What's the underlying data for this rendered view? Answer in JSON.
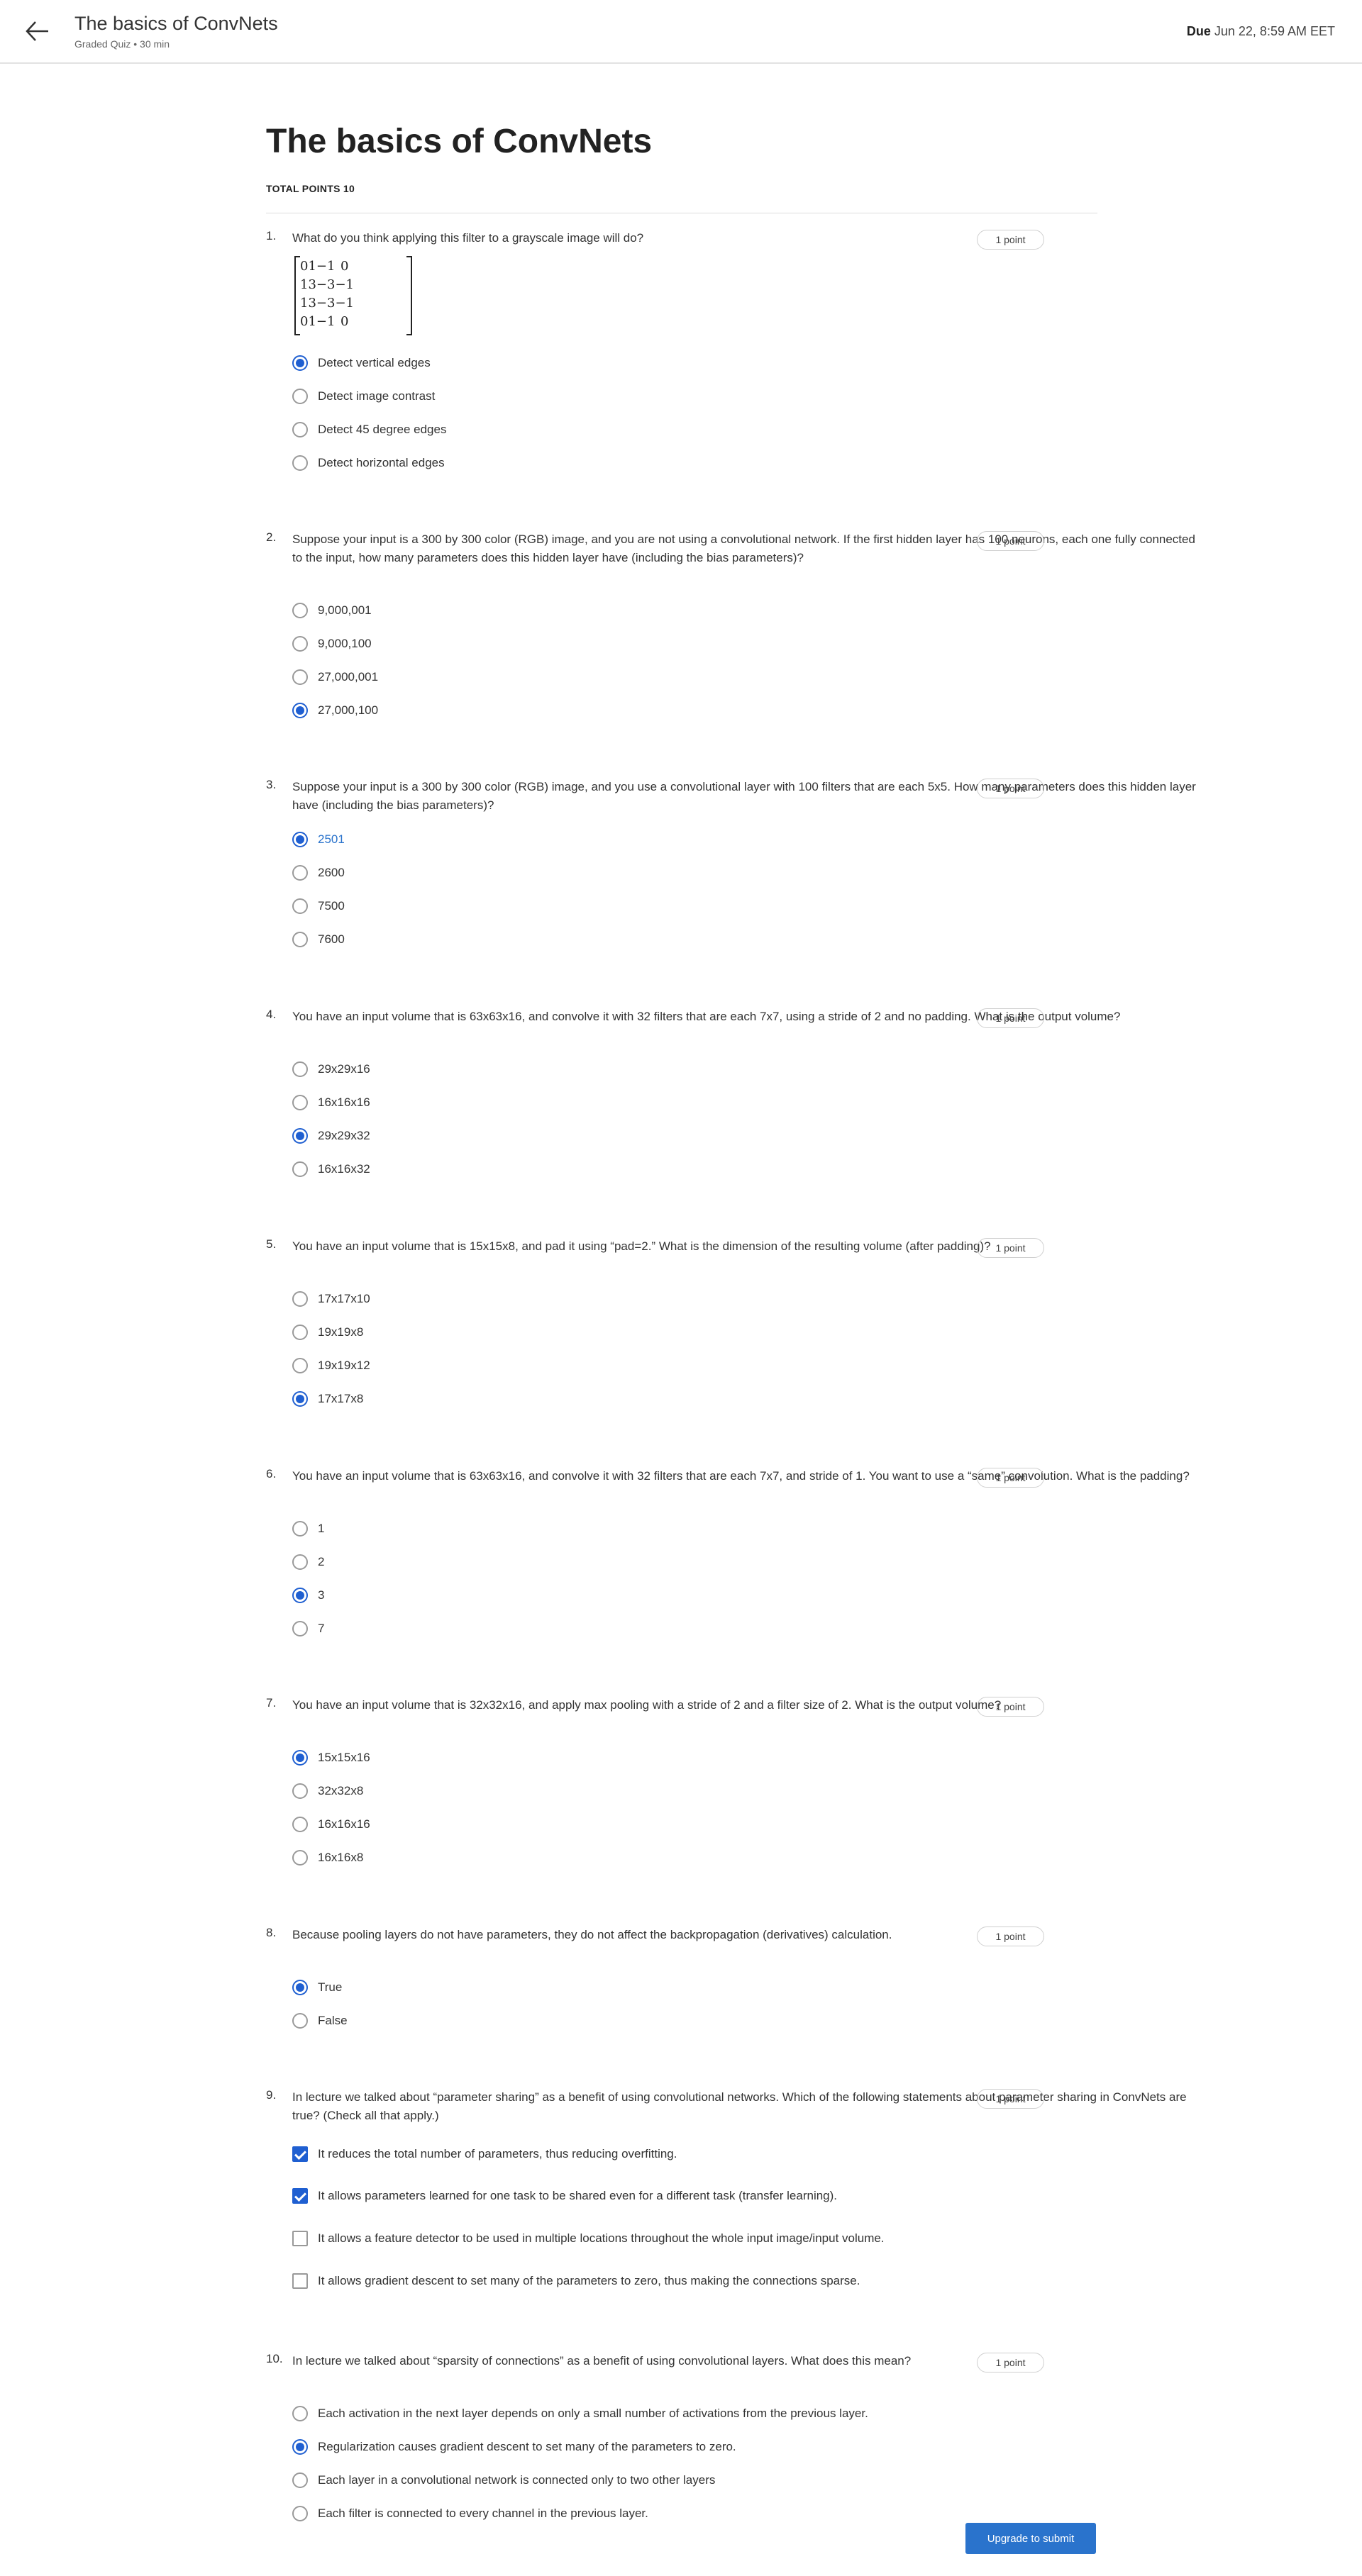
{
  "header": {
    "title": "The basics of ConvNets",
    "subtitle": "Graded Quiz • 30 min",
    "due_label": "Due",
    "due_value": "Jun 22, 8:59 AM EET"
  },
  "page": {
    "title": "The basics of ConvNets",
    "total_points": "TOTAL POINTS 10"
  },
  "questions": [
    {
      "number": "1.",
      "text": "What do you think applying this filter to a grayscale image will do?",
      "points": "1 point",
      "matrix": [
        [
          "0",
          "1",
          "−1",
          "0"
        ],
        [
          "1",
          "3",
          "−3",
          "−1"
        ],
        [
          "1",
          "3",
          "−3",
          "−1"
        ],
        [
          "0",
          "1",
          "−1",
          "0"
        ]
      ],
      "options": [
        {
          "label": "Detect vertical edges",
          "selected": true
        },
        {
          "label": "Detect image contrast",
          "selected": false
        },
        {
          "label": "Detect 45 degree edges",
          "selected": false
        },
        {
          "label": "Detect horizontal edges",
          "selected": false
        }
      ]
    },
    {
      "number": "2.",
      "text": "Suppose your input is a 300 by 300 color (RGB) image, and you are not using a convolutional network. If the first hidden layer has 100 neurons, each one fully connected to the input, how many parameters does this hidden layer have (including the bias parameters)?",
      "points": "1 point",
      "options": [
        {
          "label": "9,000,001",
          "selected": false
        },
        {
          "label": "9,000,100",
          "selected": false
        },
        {
          "label": "27,000,001",
          "selected": false
        },
        {
          "label": "27,000,100",
          "selected": true
        }
      ]
    },
    {
      "number": "3.",
      "text": "Suppose your input is a 300 by 300 color (RGB) image, and you use a convolutional layer with 100 filters that are each 5x5. How many parameters does this hidden layer have (including the bias parameters)?",
      "points": "1 point",
      "options": [
        {
          "label": "2501",
          "selected": true
        },
        {
          "label": "2600",
          "selected": false
        },
        {
          "label": "7500",
          "selected": false
        },
        {
          "label": "7600",
          "selected": false
        }
      ]
    },
    {
      "number": "4.",
      "text": "You have an input volume that is 63x63x16, and convolve it with 32 filters that are each 7x7, using a stride of 2 and no padding. What is the output volume?",
      "points": "1 point",
      "options": [
        {
          "label": "29x29x16",
          "selected": false
        },
        {
          "label": "16x16x16",
          "selected": false
        },
        {
          "label": "29x29x32",
          "selected": true
        },
        {
          "label": "16x16x32",
          "selected": false
        }
      ]
    },
    {
      "number": "5.",
      "text": "You have an input volume that is 15x15x8, and pad it using “pad=2.” What is the dimension of the resulting volume (after padding)?",
      "points": "1 point",
      "options": [
        {
          "label": "17x17x10",
          "selected": false
        },
        {
          "label": "19x19x8",
          "selected": false
        },
        {
          "label": "19x19x12",
          "selected": false
        },
        {
          "label": "17x17x8",
          "selected": true
        }
      ]
    },
    {
      "number": "6.",
      "text": "You have an input volume that is 63x63x16, and convolve it with 32 filters that are each 7x7, and stride of 1. You want to use a “same” convolution. What is the padding?",
      "points": "1 point",
      "options": [
        {
          "label": "1",
          "selected": false
        },
        {
          "label": "2",
          "selected": false
        },
        {
          "label": "3",
          "selected": true
        },
        {
          "label": "7",
          "selected": false
        }
      ]
    },
    {
      "number": "7.",
      "text": "You have an input volume that is 32x32x16, and apply max pooling with a stride of 2 and a filter size of 2. What is the output volume?",
      "points": "1 point",
      "options": [
        {
          "label": "15x15x16",
          "selected": true
        },
        {
          "label": "32x32x8",
          "selected": false
        },
        {
          "label": "16x16x16",
          "selected": false
        },
        {
          "label": "16x16x8",
          "selected": false
        }
      ]
    },
    {
      "number": "8.",
      "text": "Because pooling layers do not have parameters, they do not affect the backpropagation (derivatives) calculation.",
      "points": "1 point",
      "options": [
        {
          "label": "True",
          "selected": true
        },
        {
          "label": "False",
          "selected": false
        }
      ]
    },
    {
      "number": "9.",
      "text": "In lecture we talked about “parameter sharing” as a benefit of using convolutional networks. Which of the following statements about parameter sharing in ConvNets are true? (Check all that apply.)",
      "points": "1 point",
      "options": [
        {
          "label": "It reduces the total number of parameters, thus reducing overfitting.",
          "selected": true
        },
        {
          "label": "It allows parameters learned for one task to be shared even for a different task (transfer learning).",
          "selected": true
        },
        {
          "label": "It allows a feature detector to be used in multiple locations throughout the whole input image/input volume.",
          "selected": false
        },
        {
          "label": "It allows gradient descent to set many of the parameters to zero, thus making the connections sparse.",
          "selected": false
        }
      ]
    },
    {
      "number": "10.",
      "text": "In lecture we talked about “sparsity of connections” as a benefit of using convolutional layers. What does this mean?",
      "points": "1 point",
      "options": [
        {
          "label": "Each activation in the next layer depends on only a small number of activations from the previous layer.",
          "selected": false
        },
        {
          "label": "Regularization causes gradient descent to set many of the parameters to zero.",
          "selected": true
        },
        {
          "label": "Each layer in a convolutional network is connected only to two other layers",
          "selected": false
        },
        {
          "label": "Each filter is connected to every channel in the previous layer.",
          "selected": false
        }
      ]
    }
  ],
  "footer": {
    "submit_label": "Upgrade to submit"
  },
  "colors": {
    "accent": "#1f5fd1",
    "button": "#2a73cc"
  }
}
